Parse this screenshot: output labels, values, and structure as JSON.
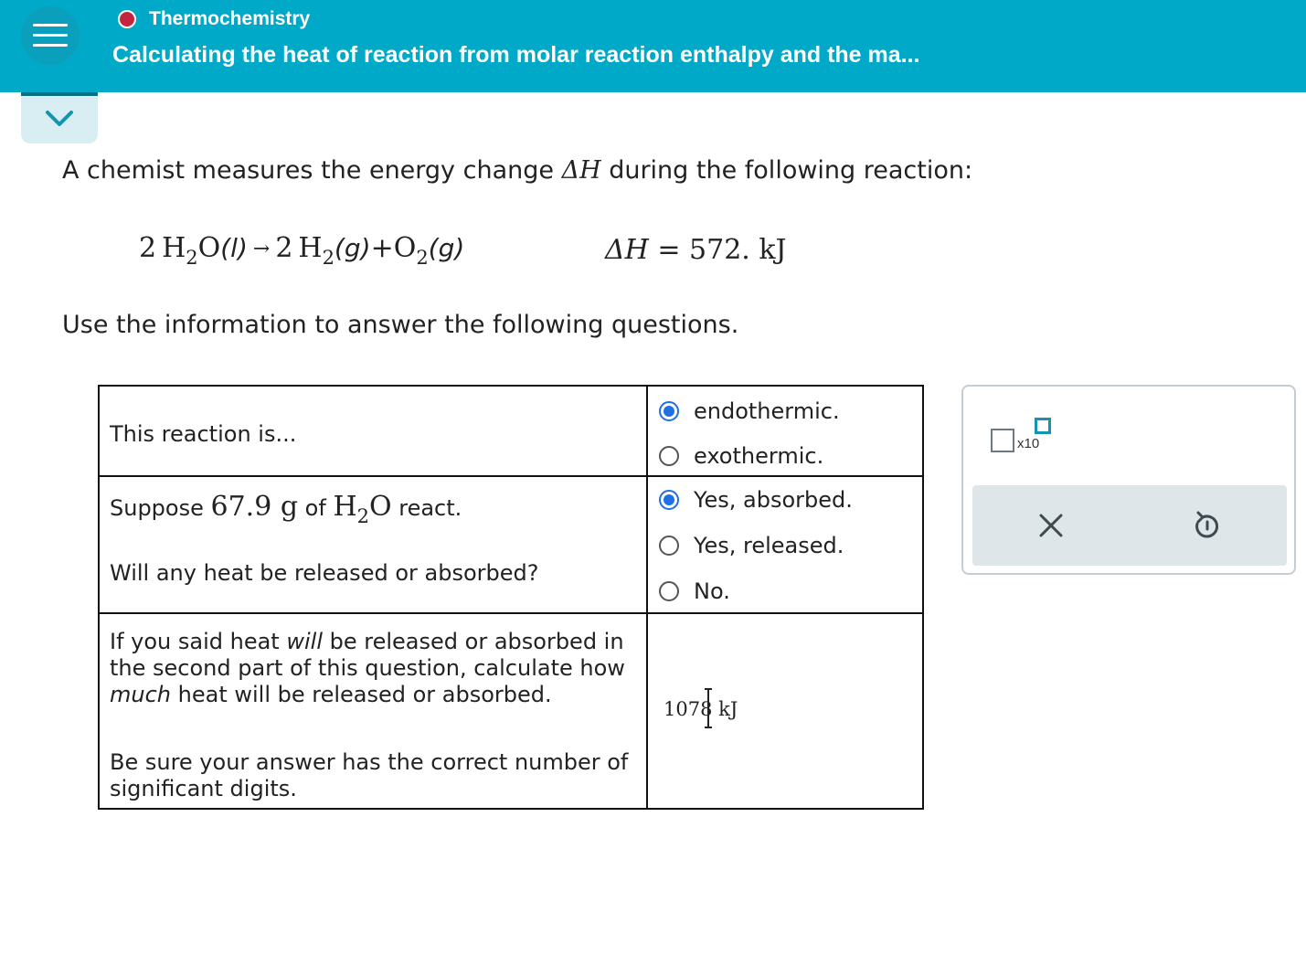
{
  "header": {
    "topic": "Thermochemistry",
    "title": "Calculating the heat of reaction from molar reaction enthalpy and the ma..."
  },
  "prompt": {
    "intro_pre": "A chemist measures the energy change ",
    "intro_delta": "ΔH",
    "intro_post": " during the following reaction:",
    "instructions": "Use the information to answer the following questions."
  },
  "equation": {
    "reactant_coef": "2",
    "reactant": "H",
    "reactant_sub": "2",
    "reactant_rest": "O",
    "reactant_state": "(l)",
    "arrow": "→",
    "product1_coef": "2",
    "product1": "H",
    "product1_sub": "2",
    "product1_state": "(g)",
    "plus": "+",
    "product2": "O",
    "product2_sub": "2",
    "product2_state": "(g)",
    "dh_label": "ΔH",
    "dh_eq": " = ",
    "dh_value": "572. kJ"
  },
  "table": {
    "q1": {
      "text": "This reaction is...",
      "options": [
        "endothermic.",
        "exothermic."
      ],
      "selected": 0
    },
    "q2": {
      "suppose": "Suppose ",
      "mass": "67.9",
      "unit": " g",
      "of": " of ",
      "formula": "H",
      "formula_sub": "2",
      "formula_rest": "O",
      "react": " react.",
      "question": "Will any heat be released or absorbed?",
      "options": [
        "Yes, absorbed.",
        "Yes, released.",
        "No."
      ],
      "selected": 0
    },
    "q3": {
      "line1_pre": "If you said heat ",
      "line1_em": "will",
      "line1_post": " be released or absorbed in",
      "line2": "the second part of this question, calculate how",
      "line3_em": "much",
      "line3_post": " heat will be released or absorbed.",
      "note1": "Be sure your answer has the correct number of",
      "note2": "significant digits.",
      "answer_value": "1078",
      "answer_unit": "kJ"
    }
  },
  "tools": {
    "x10_label": "x10",
    "clear_icon": "close-icon",
    "undo_icon": "undo-icon",
    "accent": "#1594b2"
  },
  "colors": {
    "header_bg": "#01a9c9",
    "topic_dot": "#c4243f",
    "radio_selected": "#1f6fe5"
  }
}
